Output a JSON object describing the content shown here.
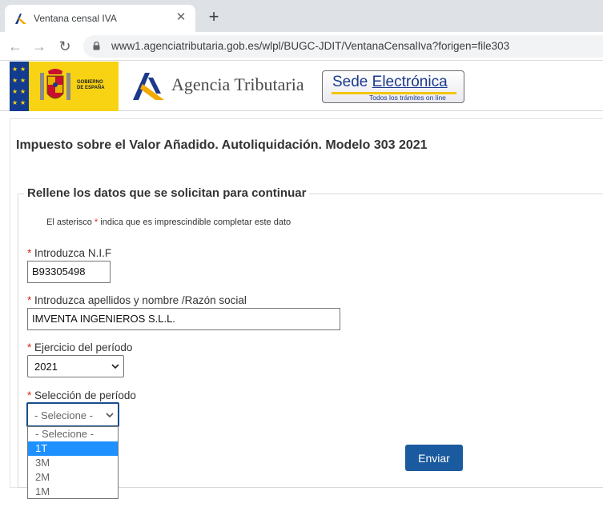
{
  "browser": {
    "tab_title": "Ventana censal IVA",
    "url": "www1.agenciatributaria.gob.es/wlpl/BUGC-JDIT/VentanaCensalIva?forigen=file303",
    "icons": {
      "back": "back-arrow-icon",
      "forward": "forward-arrow-icon",
      "reload": "reload-icon",
      "lock": "lock-icon",
      "close": "close-icon",
      "new_tab": "plus-icon"
    }
  },
  "header": {
    "gov_label_line1": "GOBIERNO",
    "gov_label_line2": "DE ESPAÑA",
    "agency_name": "Agencia Tributaria",
    "sede_title_1": "Sede ",
    "sede_title_2": "Electrónica",
    "sede_subtitle": "Todos los trámites on line"
  },
  "page": {
    "title": "Impuesto sobre el Valor Añadido. Autoliquidación. Modelo 303 2021"
  },
  "form": {
    "legend": "Rellene los datos que se solicitan para continuar",
    "hint_before": "El asterisco ",
    "hint_asterisk": "*",
    "hint_after": " indica que es imprescindible completar este dato",
    "required_mark": "*",
    "nif_label": "Introduzca N.I.F",
    "nif_value": "B93305498",
    "name_label": "Introduzca apellidos y nombre /Razón social",
    "name_value": "IMVENTA INGENIEROS S.L.L.",
    "year_label": "Ejercicio del período",
    "year_value": "2021",
    "period_label": "Selección de período",
    "period_value": "- Selecione -",
    "period_options": [
      "- Selecione -",
      "1T",
      "3M",
      "2M",
      "1M"
    ],
    "period_highlighted": "1T",
    "submit_label": "Enviar"
  },
  "colors": {
    "accent": "#1a5a9e",
    "required": "#d9251d",
    "gov_yellow": "#f7d314",
    "eu_blue": "#133b8e",
    "option_highlight": "#1e90ff"
  }
}
